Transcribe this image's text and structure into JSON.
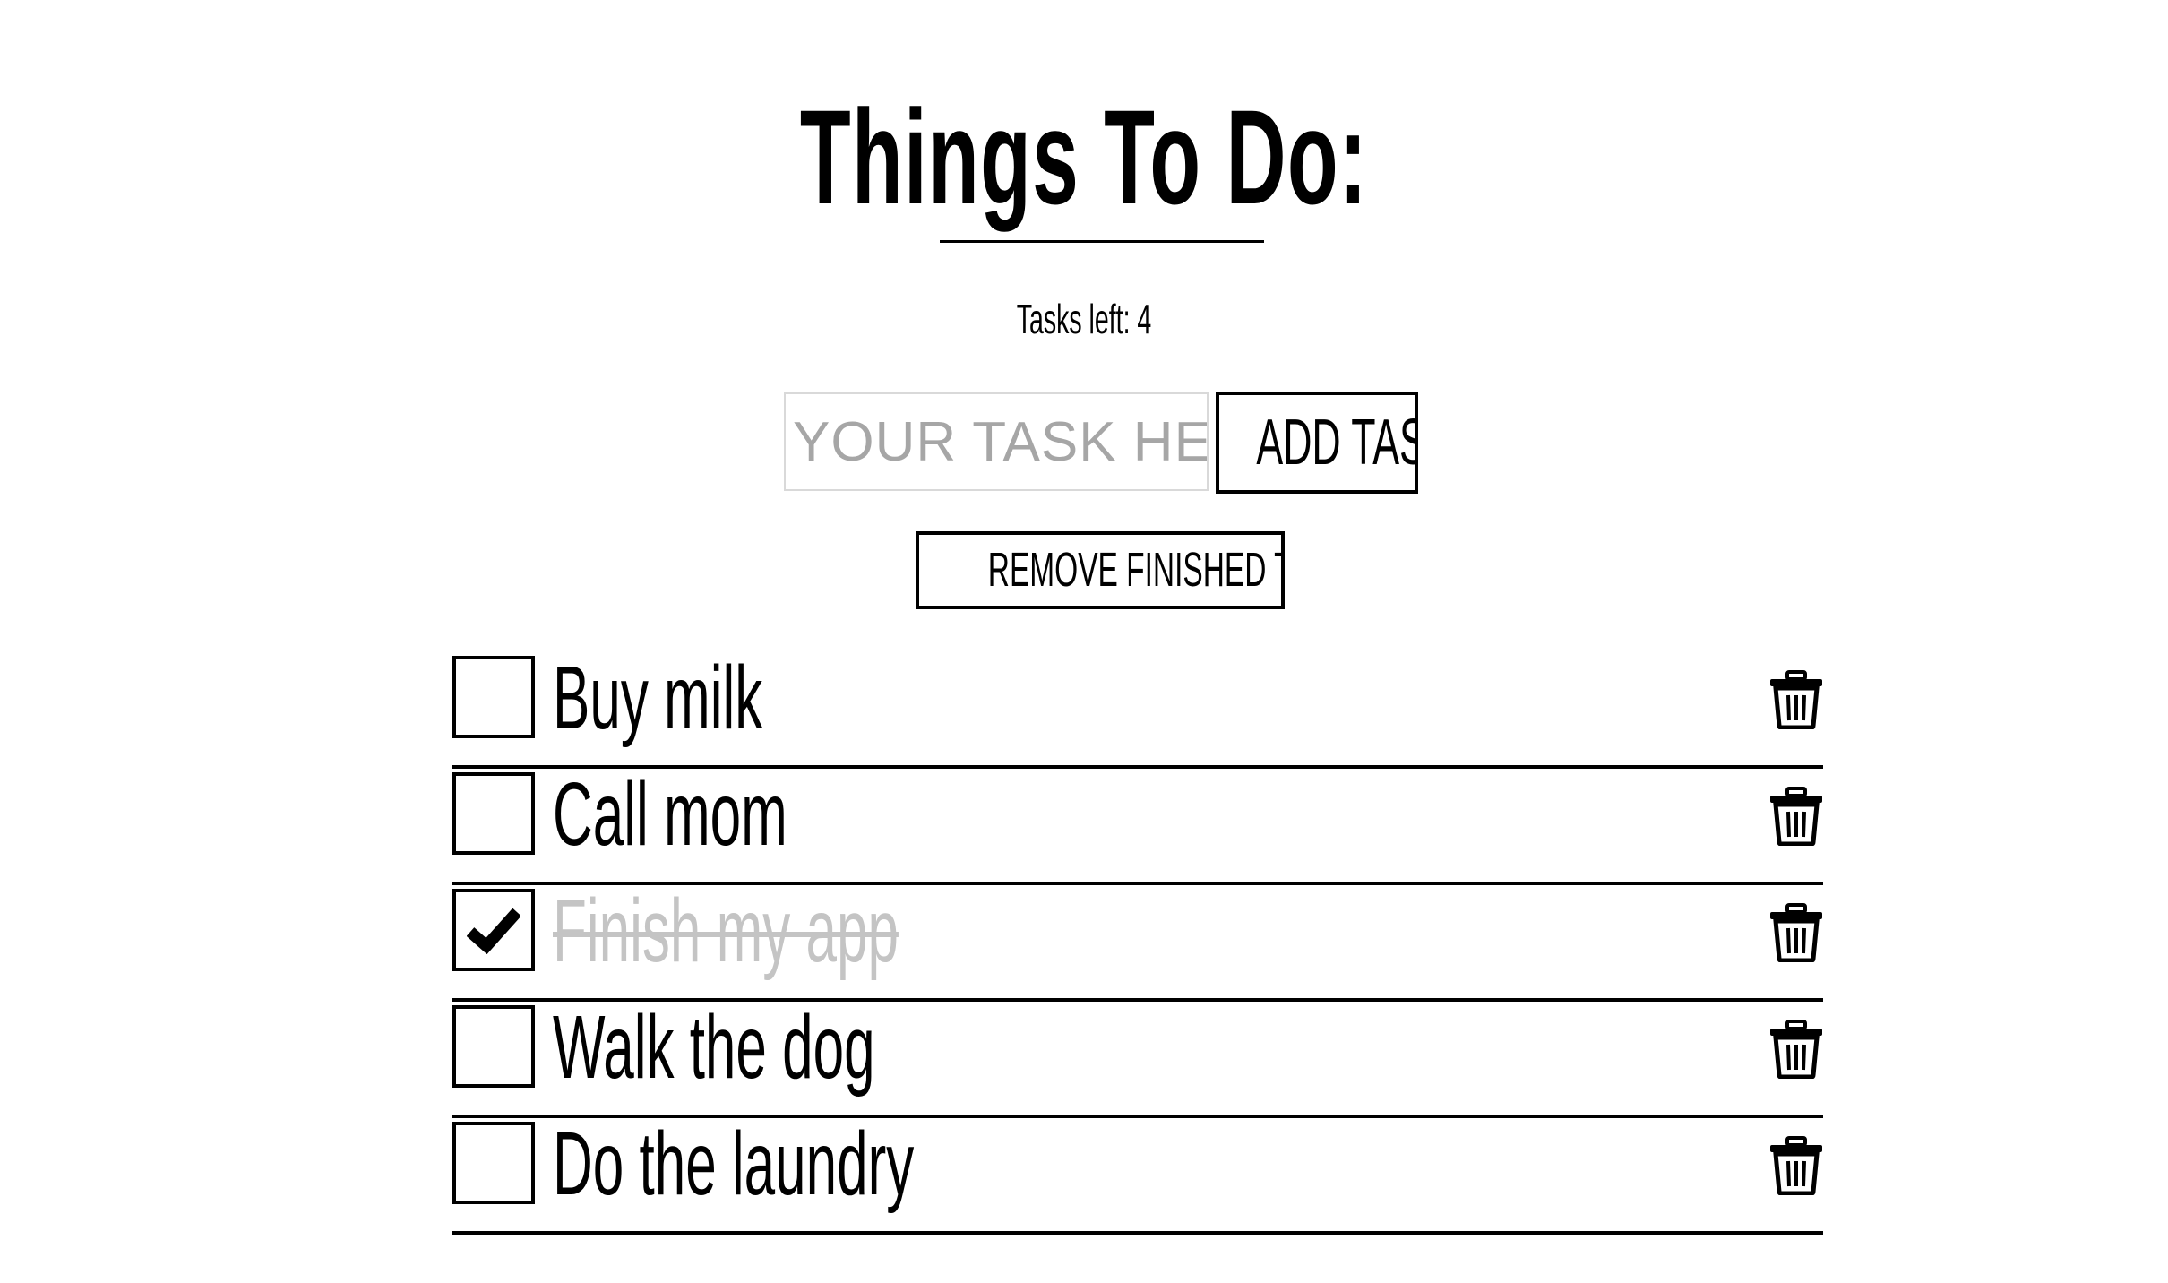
{
  "header": {
    "title": "Things To Do:",
    "tasks_left_label": "Tasks left: 4"
  },
  "form": {
    "input_placeholder": "YOUR TASK HERE",
    "input_value": "",
    "add_label": "ADD TASK",
    "remove_finished_label": "REMOVE FINISHED TASKS"
  },
  "tasks": [
    {
      "label": "Buy milk",
      "done": false
    },
    {
      "label": "Call mom",
      "done": false
    },
    {
      "label": "Finish my app",
      "done": true
    },
    {
      "label": "Walk the dog",
      "done": false
    },
    {
      "label": "Do the laundry",
      "done": false
    }
  ],
  "icons": {
    "check": "checkmark-icon",
    "delete": "trash-icon"
  },
  "colors": {
    "text": "#000000",
    "done_text": "#c4c4c4",
    "placeholder": "#a6a6a6",
    "input_border": "#d9d9d9",
    "background": "#ffffff"
  }
}
